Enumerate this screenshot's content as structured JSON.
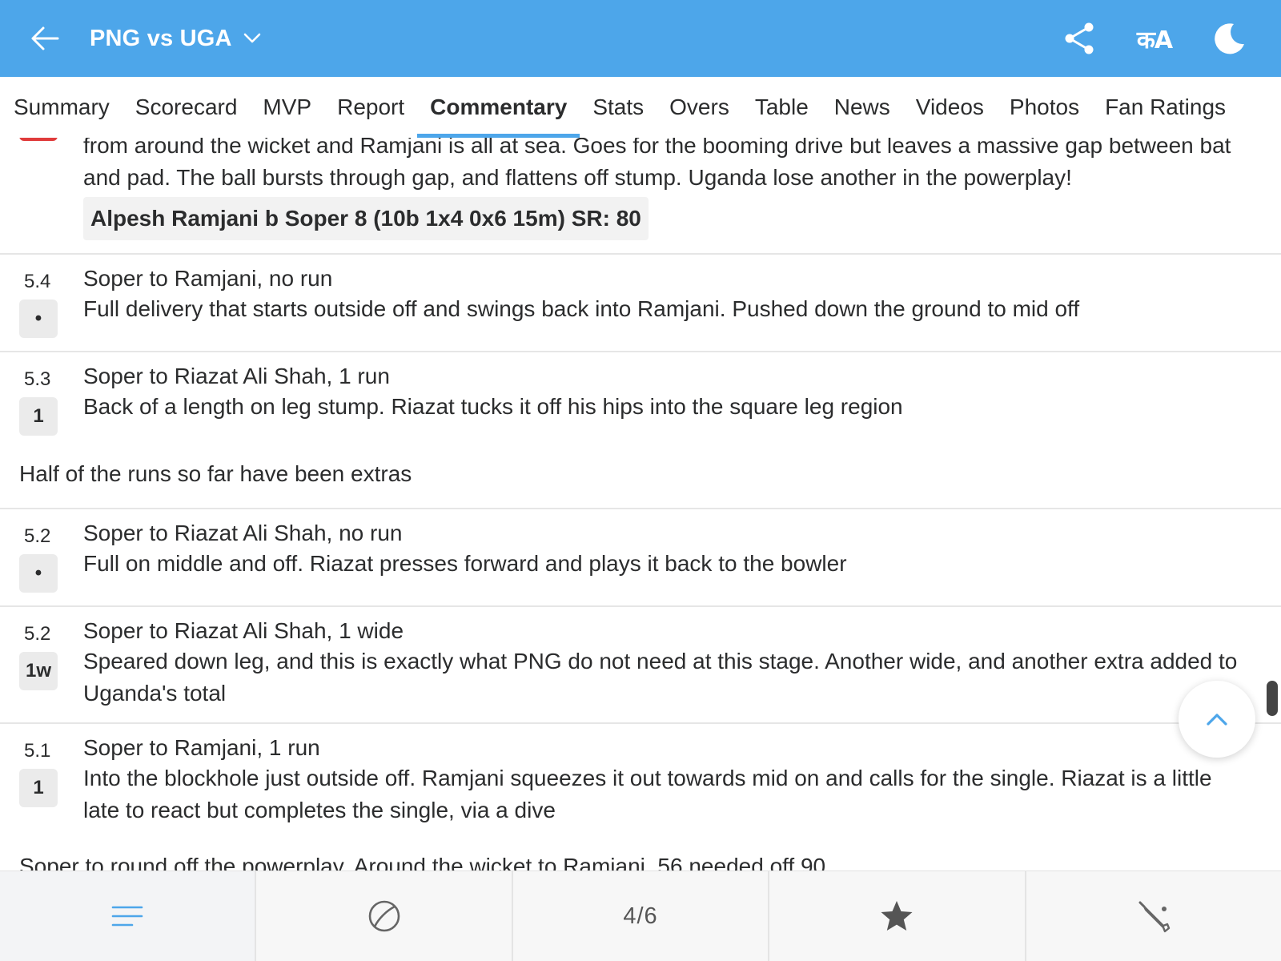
{
  "header": {
    "title": "PNG vs UGA",
    "accent_color": "#4da6ea",
    "icons": [
      "back-arrow-icon",
      "chevron-down-icon",
      "share-icon",
      "language-icon",
      "dark-mode-icon"
    ],
    "lang_label": "कA"
  },
  "tabs": [
    {
      "label": "Summary"
    },
    {
      "label": "Scorecard"
    },
    {
      "label": "MVP"
    },
    {
      "label": "Report"
    },
    {
      "label": "Commentary",
      "active": true
    },
    {
      "label": "Stats"
    },
    {
      "label": "Overs"
    },
    {
      "label": "Table"
    },
    {
      "label": "News"
    },
    {
      "label": "Videos"
    },
    {
      "label": "Photos"
    },
    {
      "label": "Fan Ratings"
    }
  ],
  "commentary": {
    "wicket_entry": {
      "body": "from around the wicket and Ramjani is all at sea. Goes for the booming drive but leaves a massive gap between bat and pad. The ball bursts through gap, and flattens off stump. Uganda lose another in the powerplay!",
      "dismissal": "Alpesh Ramjani b Soper 8 (10b 1x4 0x6 15m) SR: 80"
    },
    "balls": [
      {
        "over": "5.4",
        "result": "•",
        "head": "Soper to Ramjani, no run",
        "body": "Full delivery that starts outside off and swings back into Ramjani. Pushed down the ground to mid off"
      },
      {
        "over": "5.3",
        "result": "1",
        "head": "Soper to Riazat Ali Shah, 1 run",
        "body": "Back of a length on leg stump. Riazat tucks it off his hips into the square leg region"
      },
      {
        "over": "5.2",
        "result": "•",
        "head": "Soper to Riazat Ali Shah, no run",
        "body": "Full on middle and off. Riazat presses forward and plays it back to the bowler"
      },
      {
        "over": "5.2",
        "result": "1w",
        "head": "Soper to Riazat Ali Shah, 1 wide",
        "body": "Speared down leg, and this is exactly what PNG do not need at this stage. Another wide, and another extra added to Uganda's total"
      },
      {
        "over": "5.1",
        "result": "1",
        "head": "Soper to Ramjani, 1 run",
        "body": "Into the blockhole just outside off. Ramjani squeezes it out towards mid on and calls for the single. Riazat is a little late to react but completes the single, via a dive"
      }
    ],
    "note": "Half of the runs so far have been extras",
    "cut_off_text": "Soper to round off the powerplay. Around the wicket to Ramjani. 56 needed off 90"
  },
  "bottom_bar": {
    "items": [
      "menu-icon",
      "ball-icon",
      "page-indicator",
      "star-icon",
      "bat-icon"
    ],
    "page_indicator": "4/6"
  }
}
